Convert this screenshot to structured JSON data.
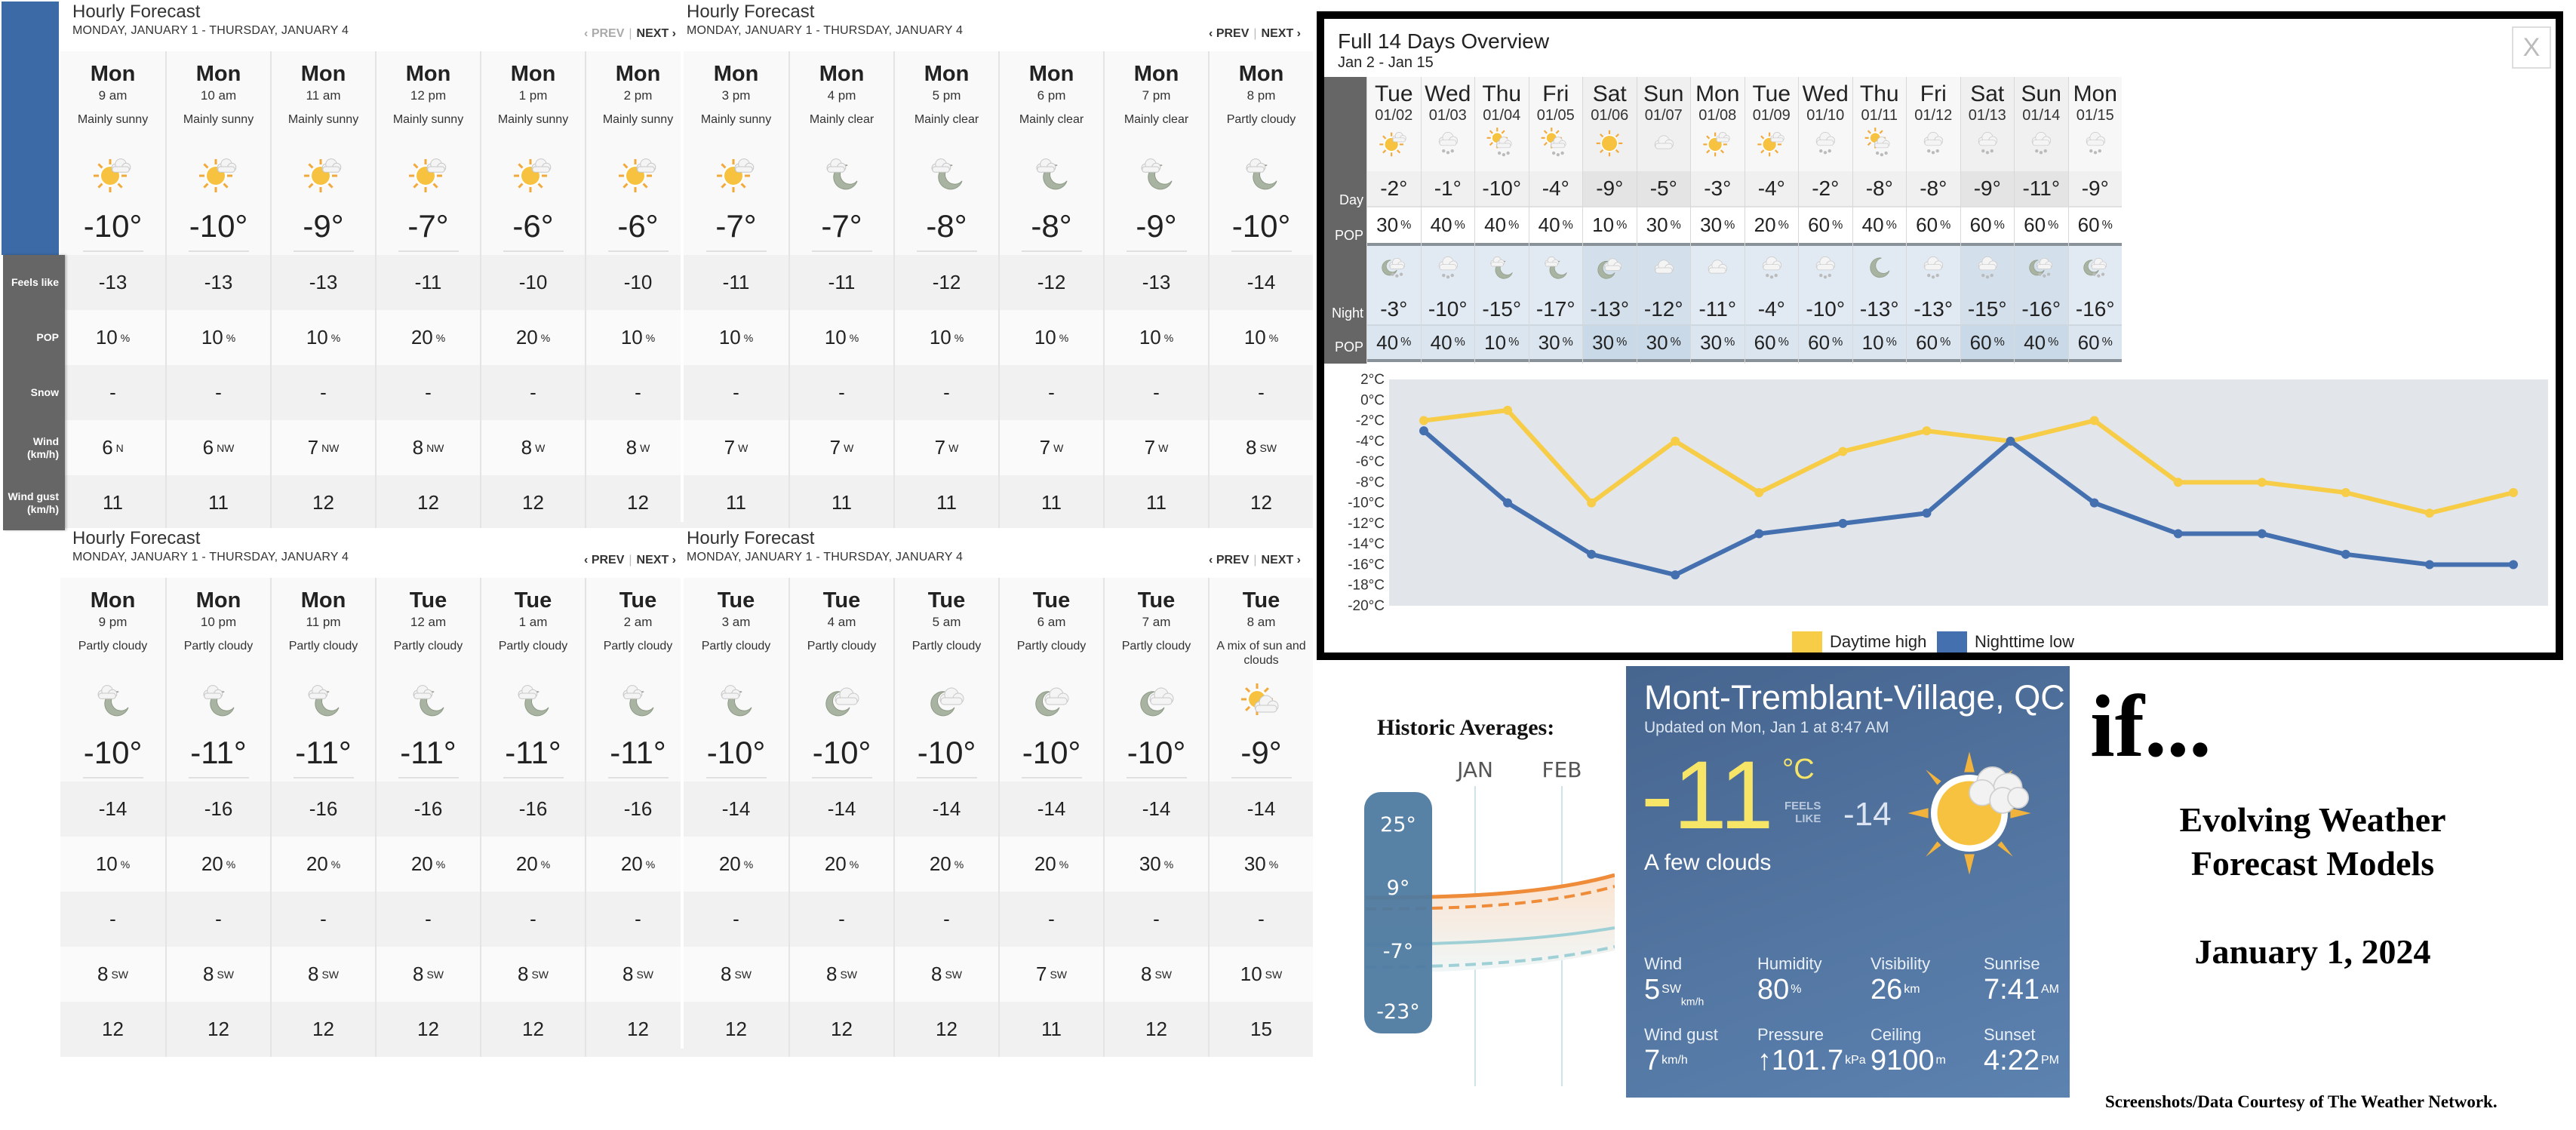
{
  "hourly_labels": [
    "Feels like",
    "POP",
    "Snow",
    "Wind (km/h)",
    "Wind gust (km/h)"
  ],
  "hourly_panels": [
    {
      "title": "Hourly Forecast",
      "subtitle": "MONDAY, JANUARY 1 - THURSDAY, JANUARY 4",
      "prev": "‹ PREV",
      "next": "NEXT ›",
      "prev_disabled": true,
      "hours": [
        {
          "day": "Mon",
          "time": "9 am",
          "cond": "Mainly sunny",
          "icon": "sun-cloud",
          "temp": "-10°",
          "feels": "-13",
          "pop": "10",
          "snow": "-",
          "wind": "6",
          "dir": "N",
          "gust": "11"
        },
        {
          "day": "Mon",
          "time": "10 am",
          "cond": "Mainly sunny",
          "icon": "sun-cloud",
          "temp": "-10°",
          "feels": "-13",
          "pop": "10",
          "snow": "-",
          "wind": "6",
          "dir": "NW",
          "gust": "11"
        },
        {
          "day": "Mon",
          "time": "11 am",
          "cond": "Mainly sunny",
          "icon": "sun-cloud",
          "temp": "-9°",
          "feels": "-13",
          "pop": "10",
          "snow": "-",
          "wind": "7",
          "dir": "NW",
          "gust": "12"
        },
        {
          "day": "Mon",
          "time": "12 pm",
          "cond": "Mainly sunny",
          "icon": "sun-cloud",
          "temp": "-7°",
          "feels": "-11",
          "pop": "20",
          "snow": "-",
          "wind": "8",
          "dir": "NW",
          "gust": "12"
        },
        {
          "day": "Mon",
          "time": "1 pm",
          "cond": "Mainly sunny",
          "icon": "sun-cloud",
          "temp": "-6°",
          "feels": "-10",
          "pop": "20",
          "snow": "-",
          "wind": "8",
          "dir": "W",
          "gust": "12"
        },
        {
          "day": "Mon",
          "time": "2 pm",
          "cond": "Mainly sunny",
          "icon": "sun-cloud",
          "temp": "-6°",
          "feels": "-10",
          "pop": "10",
          "snow": "-",
          "wind": "8",
          "dir": "W",
          "gust": "12"
        }
      ]
    },
    {
      "title": "Hourly Forecast",
      "subtitle": "MONDAY, JANUARY 1 - THURSDAY, JANUARY 4",
      "prev": "‹ PREV",
      "next": "NEXT ›",
      "prev_disabled": false,
      "hours": [
        {
          "day": "Mon",
          "time": "3 pm",
          "cond": "Mainly sunny",
          "icon": "sun-cloud",
          "temp": "-7°",
          "feels": "-11",
          "pop": "10",
          "snow": "-",
          "wind": "7",
          "dir": "W",
          "gust": "11"
        },
        {
          "day": "Mon",
          "time": "4 pm",
          "cond": "Mainly clear",
          "icon": "moon-cloud",
          "temp": "-7°",
          "feels": "-11",
          "pop": "10",
          "snow": "-",
          "wind": "7",
          "dir": "W",
          "gust": "11"
        },
        {
          "day": "Mon",
          "time": "5 pm",
          "cond": "Mainly clear",
          "icon": "moon-cloud",
          "temp": "-8°",
          "feels": "-12",
          "pop": "10",
          "snow": "-",
          "wind": "7",
          "dir": "W",
          "gust": "11"
        },
        {
          "day": "Mon",
          "time": "6 pm",
          "cond": "Mainly clear",
          "icon": "moon-cloud",
          "temp": "-8°",
          "feels": "-12",
          "pop": "10",
          "snow": "-",
          "wind": "7",
          "dir": "W",
          "gust": "11"
        },
        {
          "day": "Mon",
          "time": "7 pm",
          "cond": "Mainly clear",
          "icon": "moon-cloud",
          "temp": "-9°",
          "feels": "-13",
          "pop": "10",
          "snow": "-",
          "wind": "7",
          "dir": "W",
          "gust": "11"
        },
        {
          "day": "Mon",
          "time": "8 pm",
          "cond": "Partly cloudy",
          "icon": "moon-cloud",
          "temp": "-10°",
          "feels": "-14",
          "pop": "10",
          "snow": "-",
          "wind": "8",
          "dir": "SW",
          "gust": "12"
        }
      ]
    },
    {
      "title": "Hourly Forecast",
      "subtitle": "MONDAY, JANUARY 1 - THURSDAY, JANUARY 4",
      "prev": "‹ PREV",
      "next": "NEXT ›",
      "prev_disabled": false,
      "hours": [
        {
          "day": "Mon",
          "time": "9 pm",
          "cond": "Partly cloudy",
          "icon": "moon-cloud",
          "temp": "-10°",
          "feels": "-14",
          "pop": "10",
          "snow": "-",
          "wind": "8",
          "dir": "SW",
          "gust": "12"
        },
        {
          "day": "Mon",
          "time": "10 pm",
          "cond": "Partly cloudy",
          "icon": "moon-cloud",
          "temp": "-11°",
          "feels": "-16",
          "pop": "20",
          "snow": "-",
          "wind": "8",
          "dir": "SW",
          "gust": "12"
        },
        {
          "day": "Mon",
          "time": "11 pm",
          "cond": "Partly cloudy",
          "icon": "moon-cloud",
          "temp": "-11°",
          "feels": "-16",
          "pop": "20",
          "snow": "-",
          "wind": "8",
          "dir": "SW",
          "gust": "12"
        },
        {
          "day": "Tue",
          "time": "12 am",
          "cond": "Partly cloudy",
          "icon": "moon-cloud",
          "temp": "-11°",
          "feels": "-16",
          "pop": "20",
          "snow": "-",
          "wind": "8",
          "dir": "SW",
          "gust": "12"
        },
        {
          "day": "Tue",
          "time": "1 am",
          "cond": "Partly cloudy",
          "icon": "moon-cloud",
          "temp": "-11°",
          "feels": "-16",
          "pop": "20",
          "snow": "-",
          "wind": "8",
          "dir": "SW",
          "gust": "12"
        },
        {
          "day": "Tue",
          "time": "2 am",
          "cond": "Partly cloudy",
          "icon": "moon-cloud",
          "temp": "-11°",
          "feels": "-16",
          "pop": "20",
          "snow": "-",
          "wind": "8",
          "dir": "SW",
          "gust": "12"
        }
      ]
    },
    {
      "title": "Hourly Forecast",
      "subtitle": "MONDAY, JANUARY 1 - THURSDAY, JANUARY 4",
      "prev": "‹ PREV",
      "next": "NEXT ›",
      "prev_disabled": false,
      "hours": [
        {
          "day": "Tue",
          "time": "3 am",
          "cond": "Partly cloudy",
          "icon": "moon-cloud",
          "temp": "-10°",
          "feels": "-14",
          "pop": "20",
          "snow": "-",
          "wind": "8",
          "dir": "SW",
          "gust": "12"
        },
        {
          "day": "Tue",
          "time": "4 am",
          "cond": "Partly cloudy",
          "icon": "moon-cloudy",
          "temp": "-10°",
          "feels": "-14",
          "pop": "20",
          "snow": "-",
          "wind": "8",
          "dir": "SW",
          "gust": "12"
        },
        {
          "day": "Tue",
          "time": "5 am",
          "cond": "Partly cloudy",
          "icon": "moon-cloudy",
          "temp": "-10°",
          "feels": "-14",
          "pop": "20",
          "snow": "-",
          "wind": "8",
          "dir": "SW",
          "gust": "12"
        },
        {
          "day": "Tue",
          "time": "6 am",
          "cond": "Partly cloudy",
          "icon": "moon-cloudy",
          "temp": "-10°",
          "feels": "-14",
          "pop": "20",
          "snow": "-",
          "wind": "7",
          "dir": "SW",
          "gust": "11"
        },
        {
          "day": "Tue",
          "time": "7 am",
          "cond": "Partly cloudy",
          "icon": "moon-cloudy",
          "temp": "-10°",
          "feels": "-14",
          "pop": "30",
          "snow": "-",
          "wind": "8",
          "dir": "SW",
          "gust": "12"
        },
        {
          "day": "Tue",
          "time": "8 am",
          "cond": "A mix of sun and clouds",
          "icon": "sun-cloudy",
          "temp": "-9°",
          "feels": "-14",
          "pop": "30",
          "snow": "-",
          "wind": "10",
          "dir": "SW",
          "gust": "15"
        }
      ]
    }
  ],
  "overview": {
    "title": "Full 14 Days Overview",
    "subtitle": "Jan 2 - Jan 15",
    "close_label": "X",
    "row_labels": {
      "day": "Day",
      "pop": "POP",
      "night": "Night",
      "npop": "POP"
    },
    "days": [
      {
        "name": "Tue",
        "date": "01/02",
        "day_icon": "sun-cloud",
        "day_temp": "-2°",
        "day_pop": "30",
        "night_icon": "moon-snow",
        "night_temp": "-3°",
        "night_pop": "40",
        "weekend": false
      },
      {
        "name": "Wed",
        "date": "01/03",
        "day_icon": "snow",
        "day_temp": "-1°",
        "day_pop": "40",
        "night_icon": "snow",
        "night_temp": "-10°",
        "night_pop": "40",
        "weekend": false
      },
      {
        "name": "Thu",
        "date": "01/04",
        "day_icon": "sun-snow",
        "day_temp": "-10°",
        "day_pop": "40",
        "night_icon": "moon-cloud",
        "night_temp": "-15°",
        "night_pop": "10",
        "weekend": false
      },
      {
        "name": "Fri",
        "date": "01/05",
        "day_icon": "sun-snow",
        "day_temp": "-4°",
        "day_pop": "40",
        "night_icon": "moon-cloud",
        "night_temp": "-17°",
        "night_pop": "30",
        "weekend": false
      },
      {
        "name": "Sat",
        "date": "01/06",
        "day_icon": "sun",
        "day_temp": "-9°",
        "day_pop": "10",
        "night_icon": "moon-cloudy",
        "night_temp": "-13°",
        "night_pop": "30",
        "weekend": true
      },
      {
        "name": "Sun",
        "date": "01/07",
        "day_icon": "cloud",
        "day_temp": "-5°",
        "day_pop": "30",
        "night_icon": "cloud",
        "night_temp": "-12°",
        "night_pop": "30",
        "weekend": true
      },
      {
        "name": "Mon",
        "date": "01/08",
        "day_icon": "sun-cloud",
        "day_temp": "-3°",
        "day_pop": "30",
        "night_icon": "cloud",
        "night_temp": "-11°",
        "night_pop": "30",
        "weekend": false
      },
      {
        "name": "Tue",
        "date": "01/09",
        "day_icon": "sun-cloud",
        "day_temp": "-4°",
        "day_pop": "20",
        "night_icon": "snow",
        "night_temp": "-4°",
        "night_pop": "60",
        "weekend": false
      },
      {
        "name": "Wed",
        "date": "01/10",
        "day_icon": "snow",
        "day_temp": "-2°",
        "day_pop": "60",
        "night_icon": "snow",
        "night_temp": "-10°",
        "night_pop": "60",
        "weekend": false
      },
      {
        "name": "Thu",
        "date": "01/11",
        "day_icon": "sun-snow",
        "day_temp": "-8°",
        "day_pop": "40",
        "night_icon": "moon",
        "night_temp": "-13°",
        "night_pop": "10",
        "weekend": false
      },
      {
        "name": "Fri",
        "date": "01/12",
        "day_icon": "snow",
        "day_temp": "-8°",
        "day_pop": "60",
        "night_icon": "snow",
        "night_temp": "-13°",
        "night_pop": "60",
        "weekend": false
      },
      {
        "name": "Sat",
        "date": "01/13",
        "day_icon": "snow",
        "day_temp": "-9°",
        "day_pop": "60",
        "night_icon": "snow",
        "night_temp": "-15°",
        "night_pop": "60",
        "weekend": true
      },
      {
        "name": "Sun",
        "date": "01/14",
        "day_icon": "snow",
        "day_temp": "-11°",
        "day_pop": "60",
        "night_icon": "moon-snow",
        "night_temp": "-16°",
        "night_pop": "40",
        "weekend": true
      },
      {
        "name": "Mon",
        "date": "01/15",
        "day_icon": "snow",
        "day_temp": "-9°",
        "day_pop": "60",
        "night_icon": "moon-snow",
        "night_temp": "-16°",
        "night_pop": "60",
        "weekend": false
      }
    ]
  },
  "chart_data": {
    "type": "line",
    "title": "",
    "xlabel": "",
    "ylabel": "",
    "x": [
      "01/02",
      "01/03",
      "01/04",
      "01/05",
      "01/06",
      "01/07",
      "01/08",
      "01/09",
      "01/10",
      "01/11",
      "01/12",
      "01/13",
      "01/14",
      "01/15"
    ],
    "series": [
      {
        "name": "Daytime high",
        "color": "#f7cc47",
        "values": [
          -2,
          -1,
          -10,
          -4,
          -9,
          -5,
          -3,
          -4,
          -2,
          -8,
          -8,
          -9,
          -11,
          -9
        ]
      },
      {
        "name": "Nighttime low",
        "color": "#4470b0",
        "values": [
          -3,
          -10,
          -15,
          -17,
          -13,
          -12,
          -11,
          -4,
          -10,
          -13,
          -13,
          -15,
          -16,
          -16
        ]
      }
    ],
    "ylim": [
      -20,
      2
    ],
    "yticks": [
      2,
      0,
      -2,
      -4,
      -6,
      -8,
      -10,
      -12,
      -14,
      -16,
      -18,
      -20
    ],
    "ytick_labels": [
      "2°C",
      "0°C",
      "-2°C",
      "-4°C",
      "-6°C",
      "-8°C",
      "-10°C",
      "-12°C",
      "-14°C",
      "-16°C",
      "-18°C",
      "-20°C"
    ],
    "grid": false,
    "legend": "bottom-center"
  },
  "historic": {
    "title": "Historic Averages:",
    "months": [
      "JAN",
      "FEB"
    ],
    "scale": [
      "25°",
      "9°",
      "-7°",
      "-23°"
    ],
    "colors": {
      "high": "#ee8c3a",
      "low": "#9fd0d6",
      "scale_bg": "#4e7aa0"
    }
  },
  "current": {
    "city": "Mont-Tremblant-Village, QC",
    "updated": "Updated on Mon, Jan 1 at 8:47 AM",
    "temp": "-11",
    "unit": "°C",
    "feels_label": "FEELS LIKE",
    "feels_value": "-14",
    "condition": "A few clouds",
    "stats": [
      {
        "label": "Wind",
        "value": "5",
        "sup": "SW",
        "sub": "km/h"
      },
      {
        "label": "Humidity",
        "value": "80",
        "sup": "%",
        "sub": ""
      },
      {
        "label": "Visibility",
        "value": "26",
        "sup": "km",
        "sub": ""
      },
      {
        "label": "Sunrise",
        "value": "7:41",
        "sup": "AM",
        "sub": ""
      },
      {
        "label": "Wind gust",
        "value": "7",
        "sup": "km/h",
        "sub": ""
      },
      {
        "label": "Pressure",
        "value": "↑101.7",
        "sup": "kPa",
        "sub": ""
      },
      {
        "label": "Ceiling",
        "value": "9100",
        "sup": "m",
        "sub": ""
      },
      {
        "label": "Sunset",
        "value": "4:22",
        "sup": "PM",
        "sub": ""
      }
    ]
  },
  "caption": {
    "if": "if...",
    "headline_1": "Evolving Weather",
    "headline_2": "Forecast Models",
    "date": "January 1, 2024",
    "courtesy": "Screenshots/Data Courtesy of The Weather Network."
  }
}
